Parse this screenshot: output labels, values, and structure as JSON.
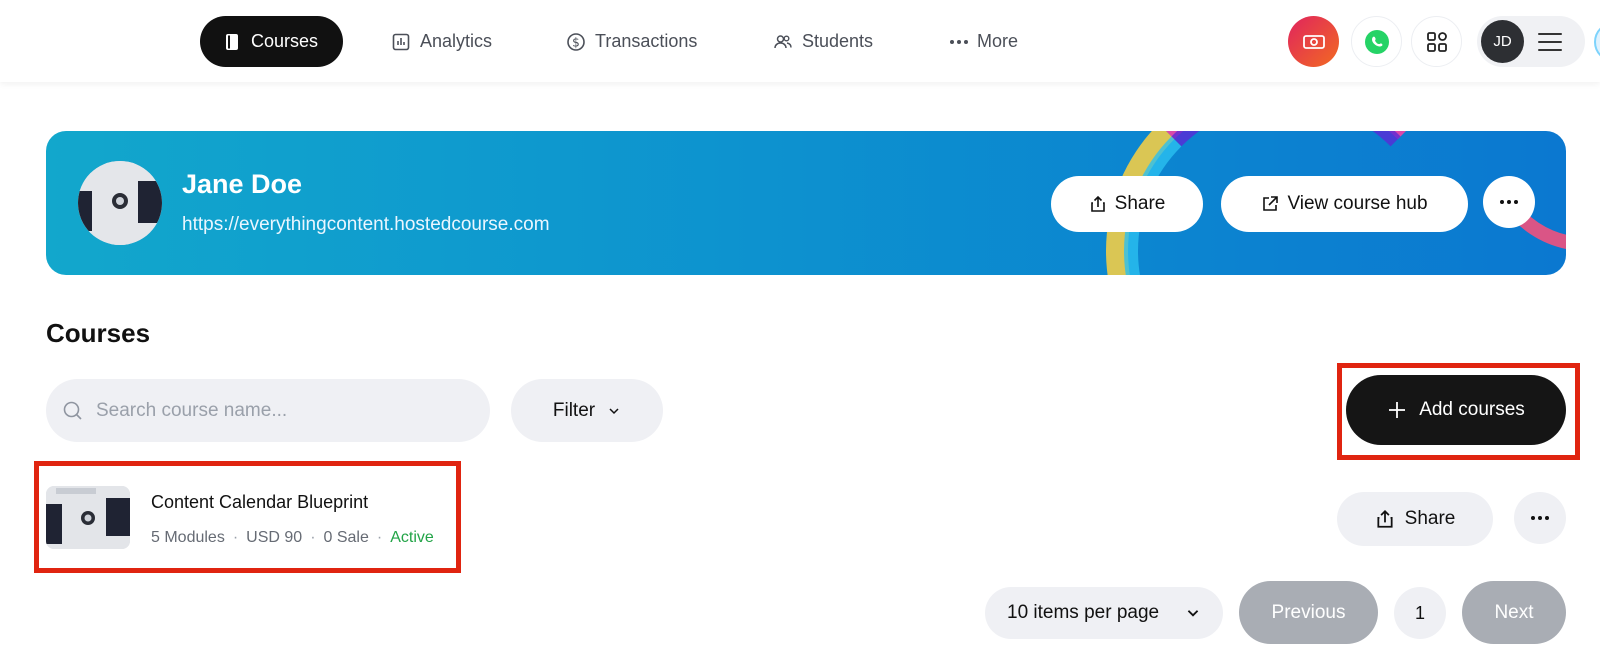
{
  "nav": {
    "items": [
      {
        "label": "Courses",
        "icon": "book-icon",
        "active": true
      },
      {
        "label": "Analytics",
        "icon": "bar-chart-icon",
        "active": false
      },
      {
        "label": "Transactions",
        "icon": "dollar-circle-icon",
        "active": false
      },
      {
        "label": "Students",
        "icon": "users-icon",
        "active": false
      },
      {
        "label": "More",
        "icon": "ellipsis-icon",
        "active": false
      }
    ],
    "avatar_initials": "JD"
  },
  "banner": {
    "name": "Jane Doe",
    "url": "https://everythingcontent.hostedcourse.com",
    "share_label": "Share",
    "view_hub_label": "View course hub"
  },
  "courses": {
    "title": "Courses",
    "search_placeholder": "Search course name...",
    "filter_label": "Filter",
    "add_label": "Add courses",
    "items": [
      {
        "title": "Content Calendar Blueprint",
        "modules": "5 Modules",
        "price": "USD 90",
        "sales": "0 Sale",
        "status": "Active",
        "share_label": "Share"
      }
    ]
  },
  "pagination": {
    "per_page": "10 items per page",
    "previous": "Previous",
    "page": "1",
    "next": "Next"
  },
  "colors": {
    "accent_dark": "#151515",
    "status_active": "#22a447",
    "highlight_box": "#e02410",
    "whatsapp": "#25d366"
  }
}
